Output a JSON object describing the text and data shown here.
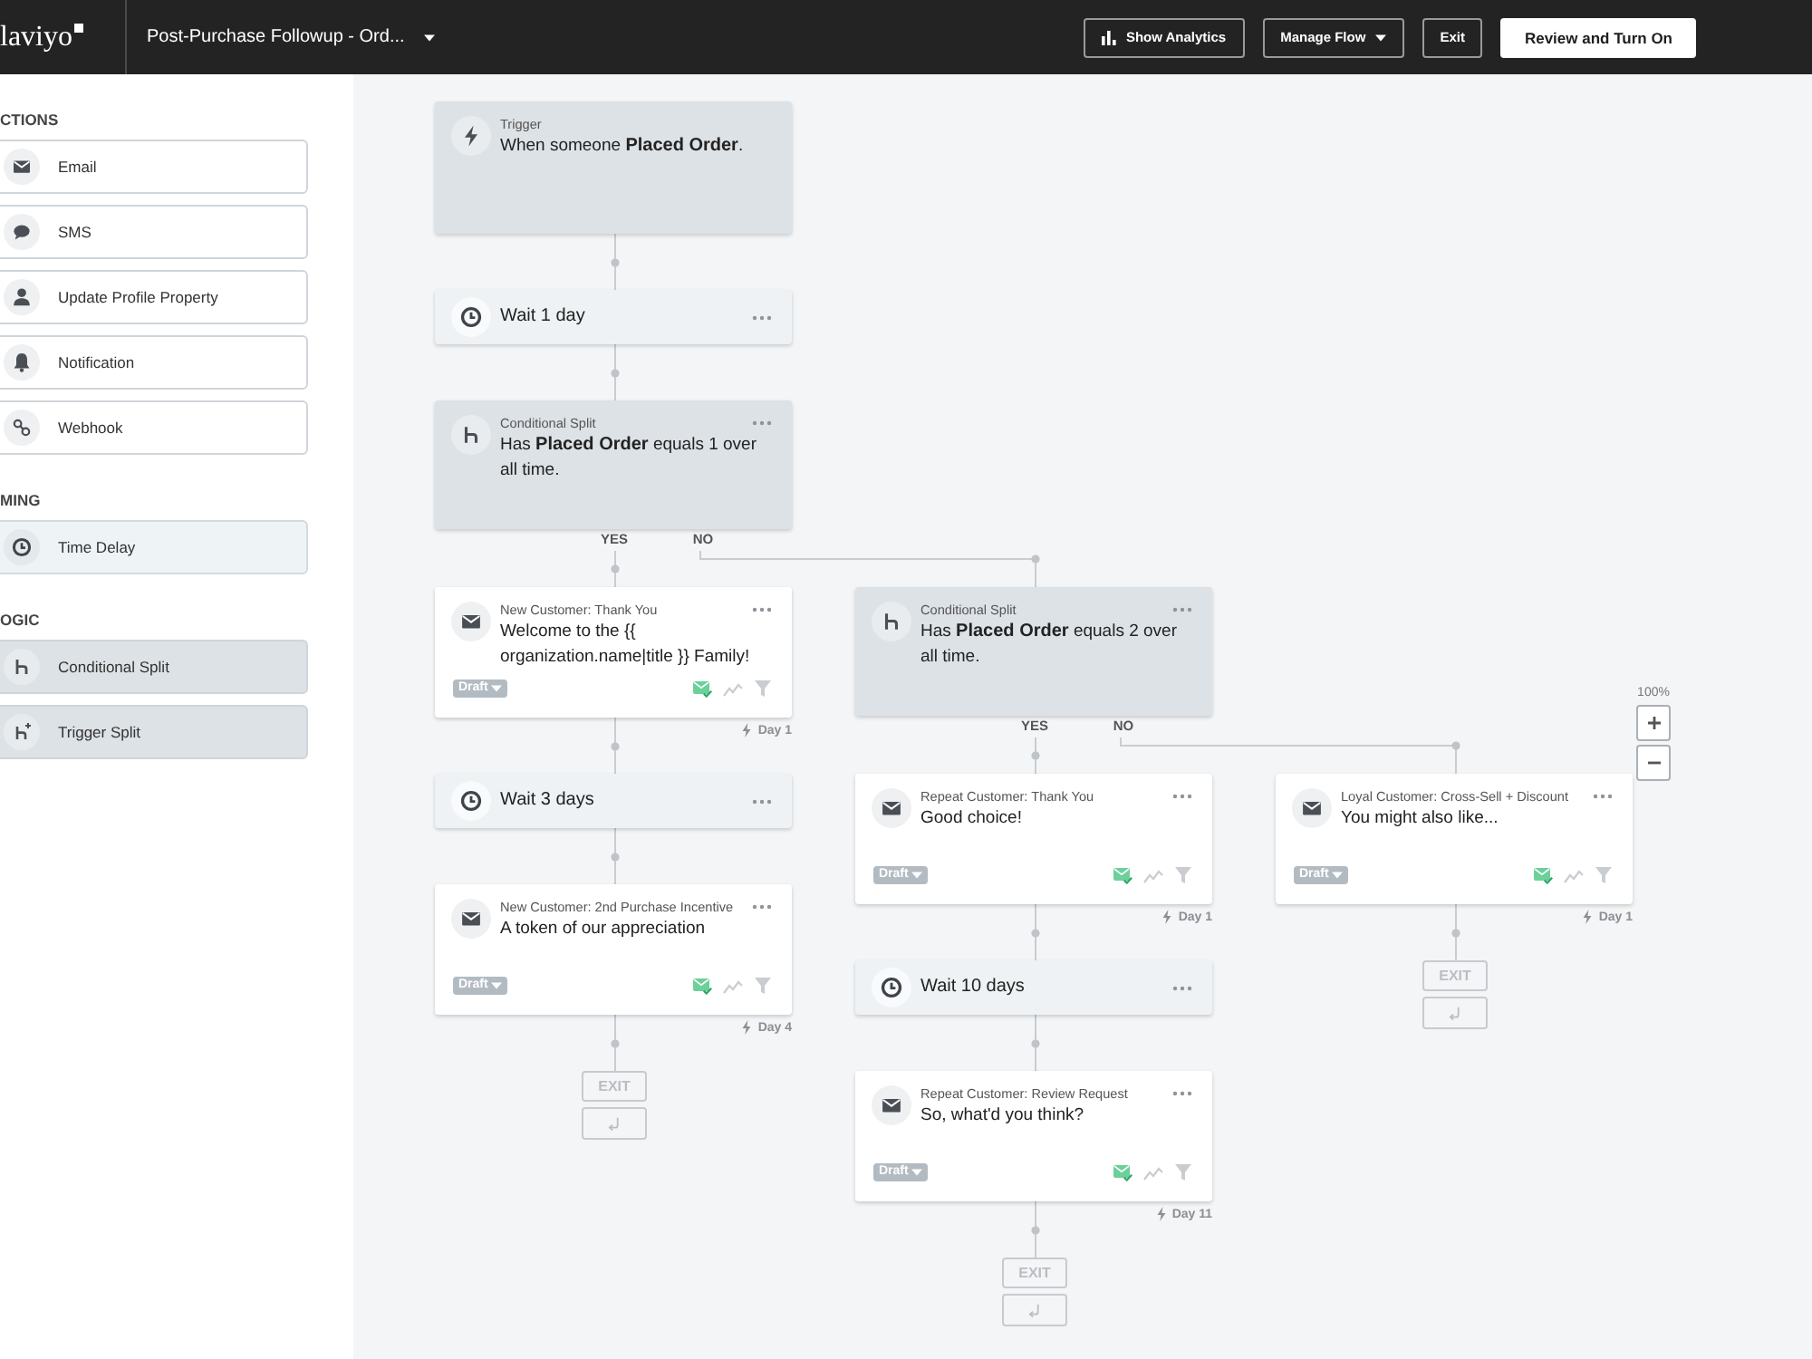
{
  "header": {
    "logo": "laviyo",
    "flow_title": "Post-Purchase Followup - Ord...",
    "buttons": [
      {
        "label": "Show Analytics",
        "kind": "analytics"
      },
      {
        "label": "Manage Flow",
        "kind": "menu"
      },
      {
        "label": "Exit",
        "kind": "plain"
      },
      {
        "label": "Review and Turn On",
        "kind": "primary"
      }
    ]
  },
  "sidebar": {
    "sections": [
      {
        "heading": "CTIONS",
        "kind": "actions",
        "items": [
          {
            "label": "Email",
            "kind": "email"
          },
          {
            "label": "SMS",
            "kind": "sms"
          },
          {
            "label": "Update Profile Property",
            "kind": "profile"
          },
          {
            "label": "Notification",
            "kind": "notification"
          },
          {
            "label": "Webhook",
            "kind": "webhook"
          }
        ]
      },
      {
        "heading": "MING",
        "kind": "timing",
        "items": [
          {
            "label": "Time Delay",
            "kind": "delay"
          }
        ]
      },
      {
        "heading": "OGIC",
        "kind": "logic",
        "items": [
          {
            "label": "Conditional Split",
            "kind": "split"
          },
          {
            "label": "Trigger Split",
            "kind": "trigger_split"
          }
        ]
      }
    ]
  },
  "flow": {
    "steps": [
      {
        "kind": "trigger",
        "title": "Trigger",
        "text": "When someone **Placed Order**."
      },
      {
        "kind": "delay",
        "text": "Wait 1 day"
      },
      {
        "kind": "split",
        "title": "Conditional Split",
        "text": "Has **Placed Order** equals 1 over all time.",
        "branches": [
          {
            "label": "YES",
            "steps": [
              {
                "kind": "email",
                "title": "New Customer: Thank You",
                "text": "Welcome to the {{ organization.name|title }} Family!",
                "status": "Draft",
                "day": "Day 1"
              },
              {
                "kind": "delay",
                "text": "Wait 3 days"
              },
              {
                "kind": "email",
                "title": "New Customer: 2nd Purchase Incentive",
                "text": "A token of our appreciation",
                "status": "Draft",
                "day": "Day 4"
              },
              {
                "kind": "exit",
                "text": "EXIT"
              }
            ]
          },
          {
            "label": "NO",
            "steps": [
              {
                "kind": "split",
                "title": "Conditional Split",
                "text": "Has **Placed Order** equals 2 over all time.",
                "branches": [
                  {
                    "label": "YES",
                    "steps": [
                      {
                        "kind": "email",
                        "title": "Repeat Customer: Thank You",
                        "text": "Good choice!",
                        "status": "Draft",
                        "day": "Day 1"
                      },
                      {
                        "kind": "delay",
                        "text": "Wait 10 days"
                      },
                      {
                        "kind": "email",
                        "title": "Repeat Customer: Review Request",
                        "text": "So, what'd you think?",
                        "status": "Draft",
                        "day": "Day 11"
                      },
                      {
                        "kind": "exit",
                        "text": "EXIT"
                      }
                    ]
                  },
                  {
                    "label": "NO",
                    "steps": [
                      {
                        "kind": "email",
                        "title": "Loyal Customer: Cross-Sell + Discount",
                        "text": "You might also like...",
                        "status": "Draft",
                        "day": "Day 1"
                      },
                      {
                        "kind": "exit",
                        "text": "EXIT"
                      }
                    ]
                  }
                ]
              }
            ]
          }
        ]
      }
    ]
  },
  "zoom": {
    "label": "100%"
  }
}
